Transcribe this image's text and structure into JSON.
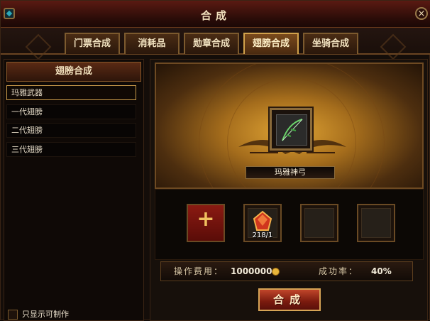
{
  "window": {
    "title": "合成",
    "close_label": "×",
    "title_icon": "gem-icon"
  },
  "tabs": [
    {
      "label": "门票合成",
      "active": false
    },
    {
      "label": "消耗品",
      "active": false
    },
    {
      "label": "勋章合成",
      "active": false
    },
    {
      "label": "翅膀合成",
      "active": true
    },
    {
      "label": "坐骑合成",
      "active": false
    }
  ],
  "sidebar": {
    "header": "翅膀合成",
    "items": [
      {
        "label": "玛雅武器",
        "selected": true
      },
      {
        "label": "一代翅膀",
        "selected": false
      },
      {
        "label": "二代翅膀",
        "selected": false
      },
      {
        "label": "三代翅膀",
        "selected": false
      }
    ],
    "filter_label": "只显示可制作"
  },
  "result": {
    "item_name": "玛雅神弓",
    "item_icon": "bow-icon"
  },
  "materials": [
    {
      "type": "add",
      "icon": "plus-icon",
      "count": ""
    },
    {
      "type": "gem",
      "icon": "red-gem-icon",
      "count": "218/1"
    },
    {
      "type": "empty",
      "icon": "",
      "count": ""
    },
    {
      "type": "empty",
      "icon": "",
      "count": ""
    }
  ],
  "cost": {
    "label": "操作费用：",
    "value": "1000000",
    "currency_icon": "gold-coin-icon",
    "rate_label": "成功率：",
    "rate_value": "40%"
  },
  "action": {
    "button_label": "合成"
  },
  "colors": {
    "accent_gold": "#d6a456",
    "button_red": "#7a1a0e",
    "title_red": "#5a1a12"
  }
}
